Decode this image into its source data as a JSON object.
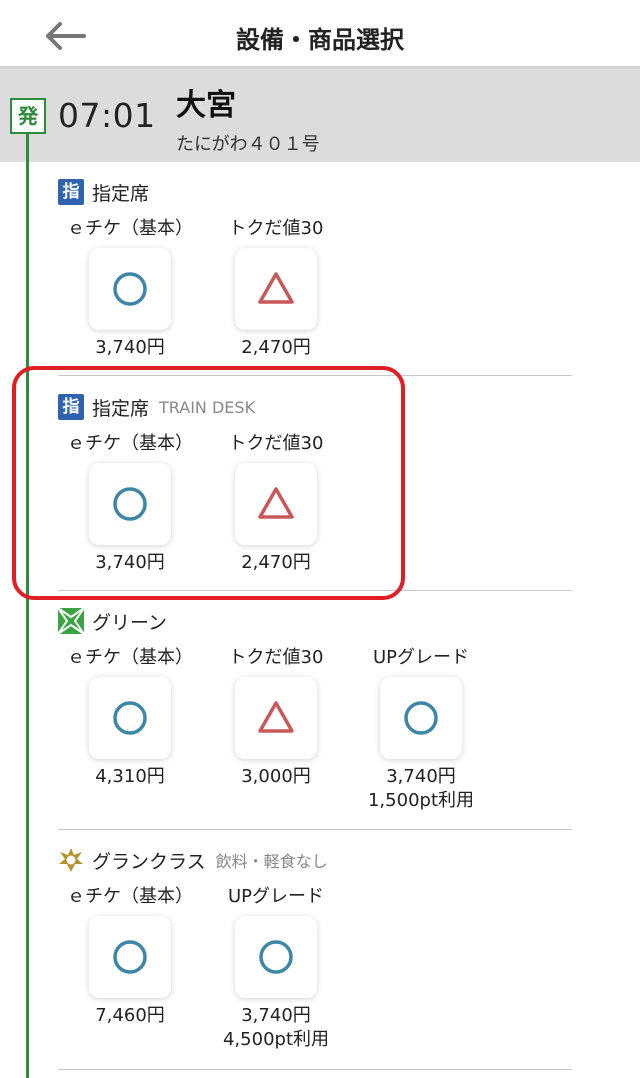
{
  "header": {
    "title": "設備・商品選択"
  },
  "departure": {
    "badge": "発",
    "time": "07:01",
    "station": "大宮",
    "train": "たにがわ４０１号"
  },
  "sections": [
    {
      "icon_text": "指",
      "name": "指定席",
      "note": "",
      "fares": [
        {
          "label": "ｅチケ（基本）",
          "status": "circle",
          "price": "3,740円"
        },
        {
          "label": "トクだ値30",
          "status": "triangle",
          "price": "2,470円"
        }
      ]
    },
    {
      "icon_text": "指",
      "name": "指定席",
      "note": "TRAIN DESK",
      "fares": [
        {
          "label": "ｅチケ（基本）",
          "status": "circle",
          "price": "3,740円"
        },
        {
          "label": "トクだ値30",
          "status": "triangle",
          "price": "2,470円"
        }
      ]
    },
    {
      "icon_text": "",
      "name": "グリーン",
      "note": "",
      "fares": [
        {
          "label": "ｅチケ（基本）",
          "status": "circle",
          "price": "4,310円"
        },
        {
          "label": "トクだ値30",
          "status": "triangle",
          "price": "3,000円"
        },
        {
          "label": "UPグレード",
          "status": "circle",
          "price": "3,740円",
          "points": "1,500pt利用"
        }
      ]
    },
    {
      "icon_text": "",
      "name": "グランクラス",
      "note": "飲料・軽食なし",
      "fares": [
        {
          "label": "ｅチケ（基本）",
          "status": "circle",
          "price": "7,460円"
        },
        {
          "label": "UPグレード",
          "status": "circle",
          "price": "3,740円",
          "points": "4,500pt利用"
        }
      ]
    }
  ],
  "colors": {
    "circle": "#3d86a8",
    "triangle": "#c8585a",
    "track": "#2e8b3a",
    "highlight": "#e01e25",
    "shitei_icon": "#2f63b0",
    "green_icon": "#3aa344",
    "gran_icon": "#b3922a"
  }
}
